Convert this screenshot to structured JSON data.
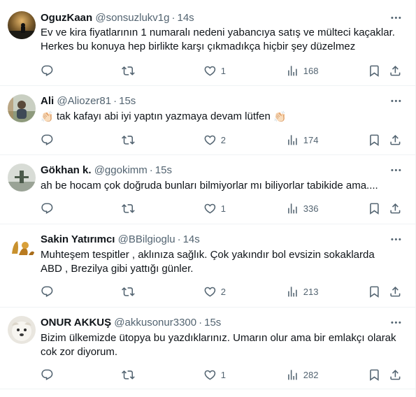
{
  "tweets": [
    {
      "name": "OguzKaan",
      "handle": "@sonsuzlukv1g",
      "dot": "·",
      "time": "14s",
      "text_lines": [
        "Ev ve kira fiyatlarının 1 numaralı nedeni yabancıya satış ve mülteci kaçaklar.",
        "Herkes bu konuya hep birlikte karşı çıkmadıkça hiçbir şey düzelmez"
      ],
      "likes": "1",
      "views": "168"
    },
    {
      "name": "Ali",
      "handle": "@Aliozer81",
      "dot": "·",
      "time": "15s",
      "text_emoji_left": "👏🏻",
      "text_main": " tak kafayı abi iyi yaptın yazmaya devam lütfen ",
      "text_emoji_right": "👏🏻",
      "likes": "2",
      "views": "174"
    },
    {
      "name": "Gökhan k.",
      "handle": "@ggokimm",
      "dot": "·",
      "time": "15s",
      "text_lines": [
        "ah be hocam çok doğruda bunları bilmiyorlar mı biliyorlar tabikide ama...."
      ],
      "likes": "1",
      "views": "336"
    },
    {
      "name": "Sakin Yatırımcı",
      "handle": "@BBilgioglu",
      "dot": "·",
      "time": "14s",
      "text_lines": [
        "Muhteşem tespitler , aklınıza sağlık. Çok yakındır bol evsizin sokaklarda",
        "ABD , Brezilya gibi yattığı günler."
      ],
      "likes": "2",
      "views": "213"
    },
    {
      "name": "ONUR AKKUŞ",
      "handle": "@akkusonur3300",
      "dot": "·",
      "time": "15s",
      "text_lines": [
        "Bizim ülkemizde ütopya bu yazdıklarınız. Umarın olur ama bir emlakçı olarak",
        "cok zor diyorum."
      ],
      "likes": "1",
      "views": "282"
    }
  ],
  "icons": {
    "reply": "reply-icon",
    "retweet": "retweet-icon",
    "like": "like-icon",
    "views": "views-icon",
    "bookmark": "bookmark-icon",
    "share": "share-icon",
    "more": "more-icon"
  }
}
